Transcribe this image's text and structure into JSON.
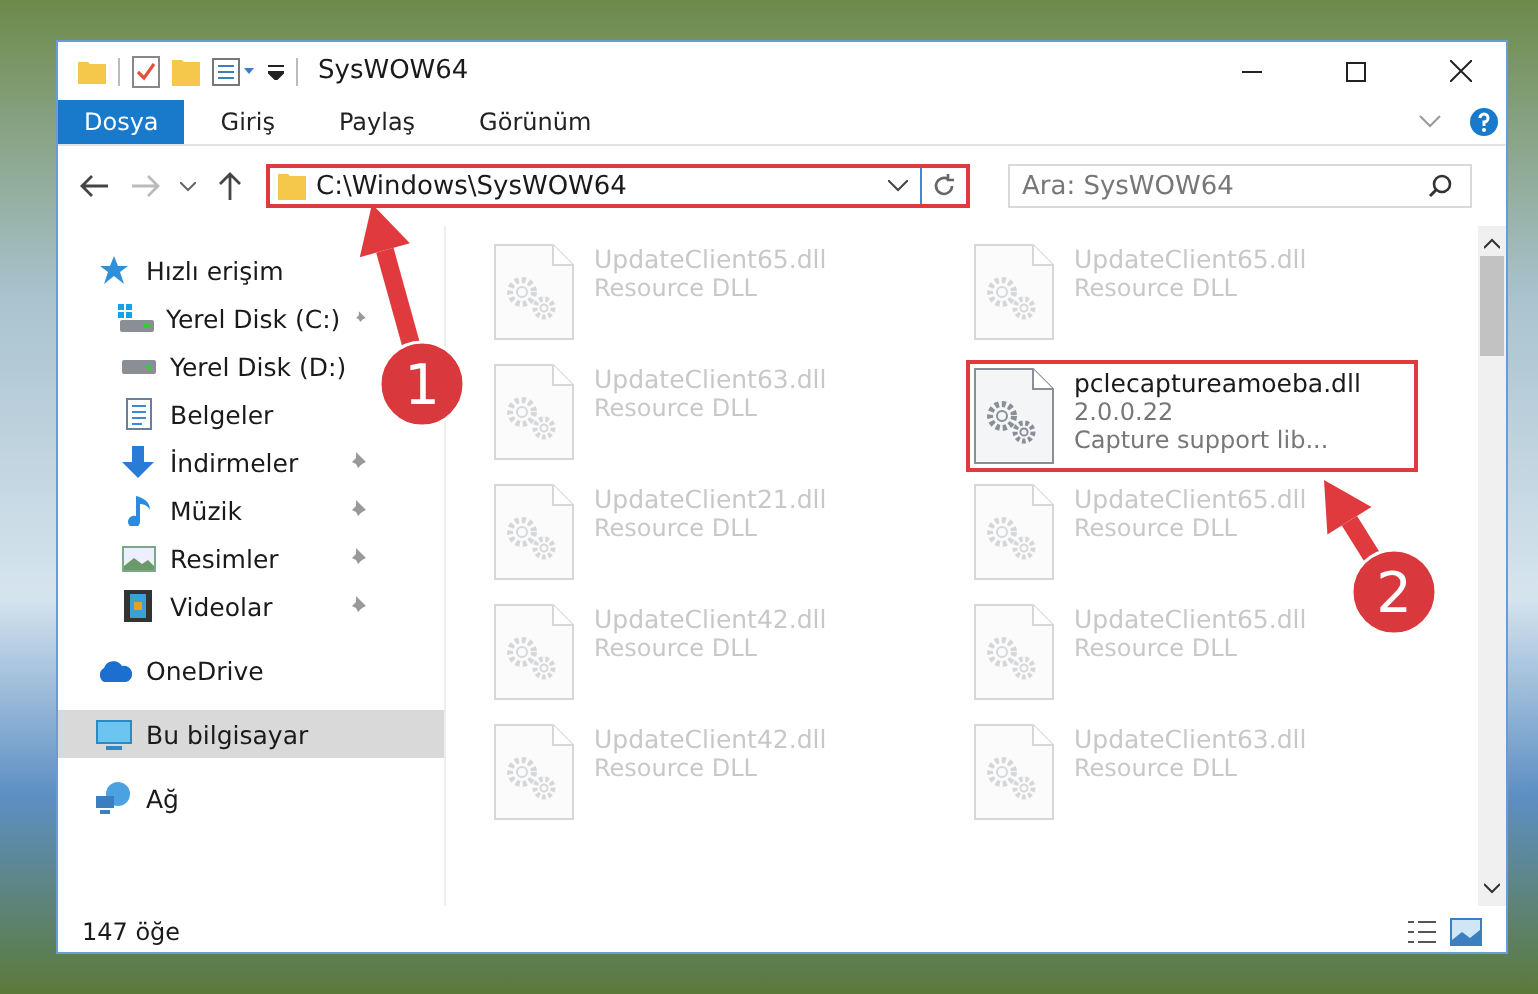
{
  "window": {
    "title": "SysWOW64"
  },
  "ribbon_tabs": [
    {
      "label": "Dosya",
      "selected": true
    },
    {
      "label": "Giriş",
      "selected": false
    },
    {
      "label": "Paylaş",
      "selected": false
    },
    {
      "label": "Görünüm",
      "selected": false
    }
  ],
  "address": {
    "path": "C:\\Windows\\SysWOW64",
    "highlighted": true
  },
  "search": {
    "placeholder": "Ara: SysWOW64"
  },
  "sidebar": {
    "items": [
      {
        "label": "Hızlı erişim",
        "kind": "star",
        "selected": false,
        "pinned": false,
        "children": [
          {
            "label": "Yerel Disk (C:)",
            "kind": "windrive",
            "selected": false,
            "pinned": true
          },
          {
            "label": "Yerel Disk (D:)",
            "kind": "drive",
            "selected": false,
            "pinned": false
          },
          {
            "label": "Belgeler",
            "kind": "documents",
            "selected": false,
            "pinned": false
          },
          {
            "label": "İndirmeler",
            "kind": "download",
            "selected": false,
            "pinned": true
          },
          {
            "label": "Müzik",
            "kind": "music",
            "selected": false,
            "pinned": true
          },
          {
            "label": "Resimler",
            "kind": "pictures",
            "selected": false,
            "pinned": true
          },
          {
            "label": "Videolar",
            "kind": "videos",
            "selected": false,
            "pinned": true
          }
        ]
      },
      {
        "label": "OneDrive",
        "kind": "cloud",
        "selected": false,
        "pinned": false
      },
      {
        "label": "Bu bilgisayar",
        "kind": "computer",
        "selected": true,
        "pinned": false
      },
      {
        "label": "Ağ",
        "kind": "network",
        "selected": false,
        "pinned": false
      }
    ]
  },
  "files": [
    {
      "name": "UpdateClient65.dll",
      "details": [
        "Resource DLL"
      ],
      "dimmed": true,
      "highlighted": false
    },
    {
      "name": "UpdateClient65.dll",
      "details": [
        "Resource DLL"
      ],
      "dimmed": true,
      "highlighted": false
    },
    {
      "name": "UpdateClient63.dll",
      "details": [
        "Resource DLL"
      ],
      "dimmed": true,
      "highlighted": false
    },
    {
      "name": "pclecaptureamoeba.dll",
      "details": [
        "2.0.0.22",
        "Capture support lib..."
      ],
      "dimmed": false,
      "highlighted": true
    },
    {
      "name": "UpdateClient21.dll",
      "details": [
        "Resource DLL"
      ],
      "dimmed": true,
      "highlighted": false
    },
    {
      "name": "UpdateClient65.dll",
      "details": [
        "Resource DLL"
      ],
      "dimmed": true,
      "highlighted": false
    },
    {
      "name": "UpdateClient42.dll",
      "details": [
        "Resource DLL"
      ],
      "dimmed": true,
      "highlighted": false
    },
    {
      "name": "UpdateClient65.dll",
      "details": [
        "Resource DLL"
      ],
      "dimmed": true,
      "highlighted": false
    },
    {
      "name": "UpdateClient42.dll",
      "details": [
        "Resource DLL"
      ],
      "dimmed": true,
      "highlighted": false
    },
    {
      "name": "UpdateClient63.dll",
      "details": [
        "Resource DLL"
      ],
      "dimmed": true,
      "highlighted": false
    }
  ],
  "status_bar": {
    "item_count": "147 öğe"
  },
  "annotations": [
    {
      "number": "1"
    },
    {
      "number": "2"
    }
  ]
}
